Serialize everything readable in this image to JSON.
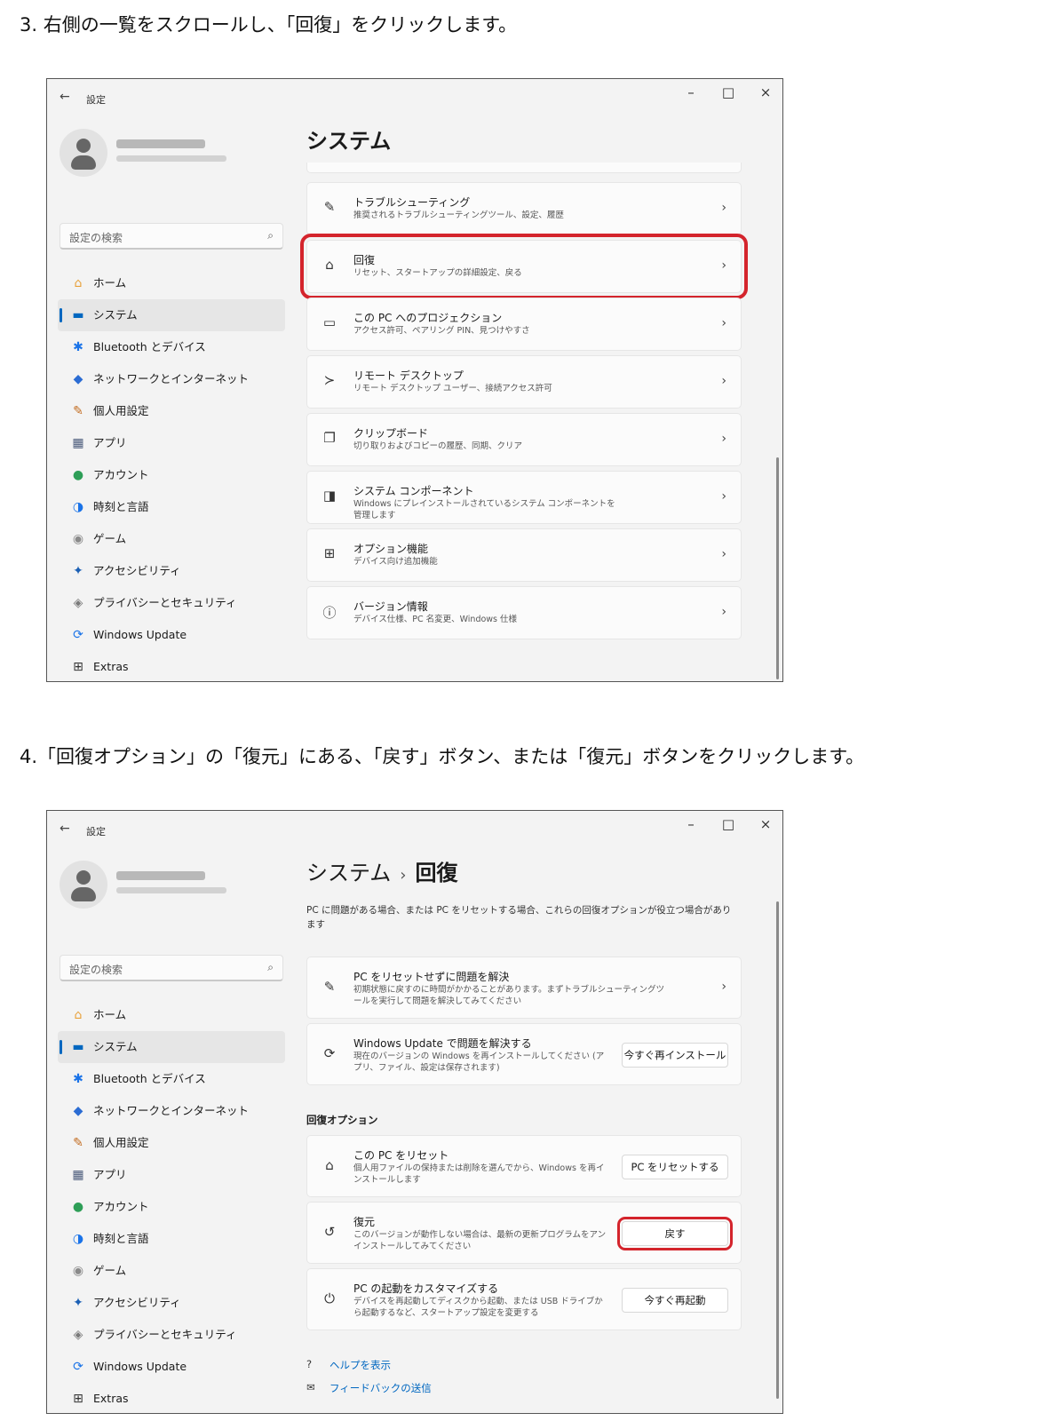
{
  "step1": "3. 右側の一覧をスクロールし、「回復」をクリックします。",
  "step2": "4.「回復オプション」の「復元」にある、「戻す」ボタン、または「復元」ボタンをクリックします。",
  "window": {
    "back": "←",
    "app_title": "設定",
    "minimize": "–",
    "maximize": "□",
    "close": "×"
  },
  "sidebar": {
    "search_placeholder": "設定の検索",
    "search_icon": "⌕",
    "items": [
      {
        "icon": "⌂",
        "label": "ホーム",
        "color": "#e8a13a"
      },
      {
        "icon": "▬",
        "label": "システム",
        "color": "#0067c0"
      },
      {
        "icon": "✱",
        "label": "Bluetooth とデバイス",
        "color": "#1a73e8"
      },
      {
        "icon": "◆",
        "label": "ネットワークとインターネット",
        "color": "#2b6cd3"
      },
      {
        "icon": "✎",
        "label": "個人用設定",
        "color": "#c26b1f"
      },
      {
        "icon": "▦",
        "label": "アプリ",
        "color": "#4a5a7a"
      },
      {
        "icon": "●",
        "label": "アカウント",
        "color": "#2e9e57"
      },
      {
        "icon": "◑",
        "label": "時刻と言語",
        "color": "#1a73e8"
      },
      {
        "icon": "◉",
        "label": "ゲーム",
        "color": "#8a8a8a"
      },
      {
        "icon": "✦",
        "label": "アクセシビリティ",
        "color": "#1a5fb4"
      },
      {
        "icon": "◈",
        "label": "プライバシーとセキュリティ",
        "color": "#7a7a7a"
      },
      {
        "icon": "⟳",
        "label": "Windows Update",
        "color": "#1a73e8"
      },
      {
        "icon": "⊞",
        "label": "Extras",
        "color": "#333333"
      }
    ]
  },
  "screen1": {
    "title": "システム",
    "cards": [
      {
        "icon": "✎",
        "title": "トラブルシューティング",
        "subtitle": "推奨されるトラブルシューティングツール、設定、履歴",
        "chevron": "›"
      },
      {
        "icon": "⌂",
        "title": "回復",
        "subtitle": "リセット、スタートアップの詳細設定、戻る",
        "chevron": "›"
      },
      {
        "icon": "▭",
        "title": "この PC へのプロジェクション",
        "subtitle": "アクセス許可、ペアリング PIN、見つけやすさ",
        "chevron": "›"
      },
      {
        "icon": "≻",
        "title": "リモート デスクトップ",
        "subtitle": "リモート デスクトップ ユーザー、接続アクセス許可",
        "chevron": "›"
      },
      {
        "icon": "❐",
        "title": "クリップボード",
        "subtitle": "切り取りおよびコピーの履歴、同期、クリア",
        "chevron": "›"
      },
      {
        "icon": "◨",
        "title": "システム コンポーネント",
        "subtitle": "Windows にプレインストールされているシステム コンポーネントを管理します",
        "chevron": "›"
      },
      {
        "icon": "⊞",
        "title": "オプション機能",
        "subtitle": "デバイス向け追加機能",
        "chevron": "›"
      },
      {
        "icon": "ⓘ",
        "title": "バージョン情報",
        "subtitle": "デバイス仕様、PC 名変更、Windows 仕様",
        "chevron": "›"
      }
    ]
  },
  "screen2": {
    "title_parent": "システム",
    "title_sep": "›",
    "title_current": "回復",
    "description": "PC に問題がある場合、または PC をリセットする場合、これらの回復オプションが役立つ場合があります",
    "top_cards": [
      {
        "icon": "✎",
        "title": "PC をリセットせずに問題を解決",
        "subtitle": "初期状態に戻すのに時間がかかることがあります。まずトラブルシューティングツールを実行して問題を解決してみてください",
        "chevron": "›"
      },
      {
        "icon": "⟳",
        "title": "Windows Update で問題を解決する",
        "subtitle": "現在のバージョンの Windows を再インストールしてください (アプリ、ファイル、設定は保存されます)",
        "button": "今すぐ再インストール"
      }
    ],
    "section_heading": "回復オプション",
    "option_cards": [
      {
        "icon": "⌂",
        "title": "この PC をリセット",
        "subtitle": "個人用ファイルの保持または削除を選んでから、Windows を再インストールします",
        "button": "PC をリセットする"
      },
      {
        "icon": "↺",
        "title": "復元",
        "subtitle": "このバージョンが動作しない場合は、最新の更新プログラムをアンインストールしてみてください",
        "button": "戻す"
      },
      {
        "icon": "⏻",
        "title": "PC の起動をカスタマイズする",
        "subtitle": "デバイスを再起動してディスクから起動、または USB ドライブから起動するなど、スタートアップ設定を変更する",
        "button": "今すぐ再起動"
      }
    ],
    "links": [
      {
        "icon": "?",
        "label": "ヘルプを表示"
      },
      {
        "icon": "✉",
        "label": "フィードバックの送信"
      }
    ]
  }
}
